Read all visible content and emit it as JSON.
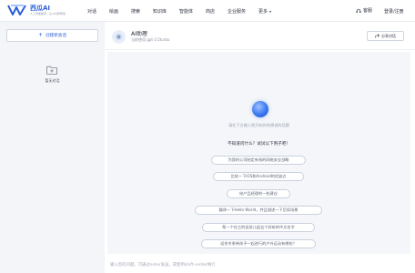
{
  "header": {
    "brand_name": "西瓜AI",
    "brand_slogan": "人工智能助手，让AI为你所用",
    "nav": [
      "对话",
      "绘画",
      "搜索",
      "知识库",
      "智能体",
      "商店",
      "企业服务",
      "更多"
    ],
    "service_label": "客服",
    "login_label": "登录/注册"
  },
  "sidebar": {
    "new_chat_label": "创建新会话",
    "empty_label": "暂无对话"
  },
  "assistant": {
    "name": "AI助理",
    "subtitle": "当前使用 gpt-3.5turbo",
    "share_label": "分享对话"
  },
  "chat": {
    "hint": "请在下方输入框开始你的想说的话题",
    "question_title": "不知道问什么？试试以下例子吧！",
    "suggestions": [
      "为我的公司制定有效的网络安全战略",
      "比较一下iOS和Android的优缺点",
      "给产品经理的一些建议",
      "翻译一下Hello World，并且描述一下后续场景",
      "帮一个在三的女孩儿起五个好听的中文名字",
      "适合冬季带孩子一起进行的户外运动有哪些？"
    ]
  },
  "input": {
    "placeholder": "输入您的问题，可通过enter发送，或使用shift+enter换行"
  },
  "colors": {
    "brand": "#2b5fd9",
    "orb": "#3a78f0",
    "background": "#f3f5f8"
  }
}
